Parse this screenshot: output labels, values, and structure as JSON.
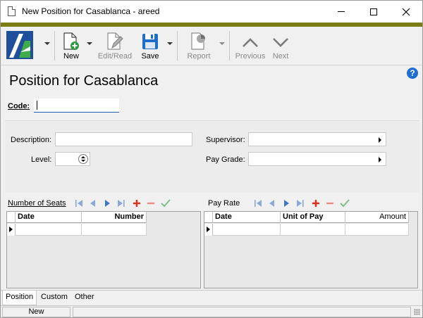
{
  "window": {
    "title": "New Position for Casablanca - areed"
  },
  "toolbar": {
    "new_label": "New",
    "editread_label": "Edit/Read",
    "save_label": "Save",
    "report_label": "Report",
    "previous_label": "Previous",
    "next_label": "Next"
  },
  "header": {
    "title": "Position for Casablanca",
    "help": "?"
  },
  "code": {
    "label": "Code:",
    "value": ""
  },
  "details": {
    "description_label": "Description:",
    "description_value": "",
    "level_label": "Level:",
    "level_value": "",
    "supervisor_label": "Supervisor:",
    "supervisor_value": "",
    "paygrade_label": "Pay Grade:",
    "paygrade_value": ""
  },
  "seats_grid": {
    "title": "Number of Seats",
    "columns": [
      "Date",
      "Number"
    ],
    "rows": []
  },
  "payrate_grid": {
    "title": "Pay Rate",
    "columns": [
      "Date",
      "Unit of Pay",
      "Amount"
    ],
    "rows": []
  },
  "tabs": [
    {
      "label": "Position",
      "active": true
    },
    {
      "label": "Custom",
      "active": false
    },
    {
      "label": "Other",
      "active": false
    }
  ],
  "status": {
    "mode": "New"
  },
  "colors": {
    "accent": "#7a7d14",
    "help": "#1e6fd0",
    "nav_blue": "#3c78c8",
    "add_red": "#e0301e",
    "confirm_green": "#7cc28a"
  }
}
